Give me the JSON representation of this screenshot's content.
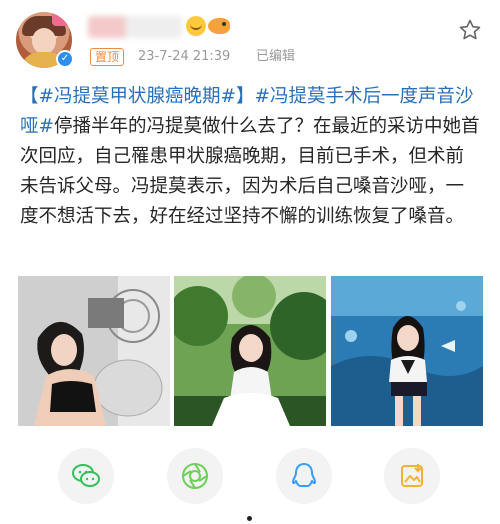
{
  "post": {
    "username": "（已打码）",
    "pinned_label": "置顶",
    "timestamp": "23-7-24 21:39",
    "edited_label": "已编辑",
    "hashtag_1": "【#冯提莫甲状腺癌晚期#】",
    "hashtag_2": "#冯提莫手术后一度声音沙哑#",
    "body": "停播半年的冯提莫做什么去了？在最近的采访中她首次回应，自己罹患甲状腺癌晚期，目前已手术，但术前未告诉父母。冯提莫表示，因为术后自己嗓音沙哑，一度不想活下去，好在经过坚持不懈的训练恢复了嗓音。"
  },
  "icons": {
    "favorite": "star-icon",
    "verified": "verified-badge-icon",
    "share_wechat": "wechat-icon",
    "share_moments": "moments-icon",
    "share_qq": "qq-icon",
    "share_save": "save-image-icon"
  },
  "colors": {
    "hashtag": "#2a6fb6",
    "pinned": "#f08a3c",
    "meta_text": "#9a9a9a",
    "wechat": "#35c05a",
    "moments": "#6fcf5a",
    "qq": "#3b9cf5",
    "save": "#f2b233"
  }
}
